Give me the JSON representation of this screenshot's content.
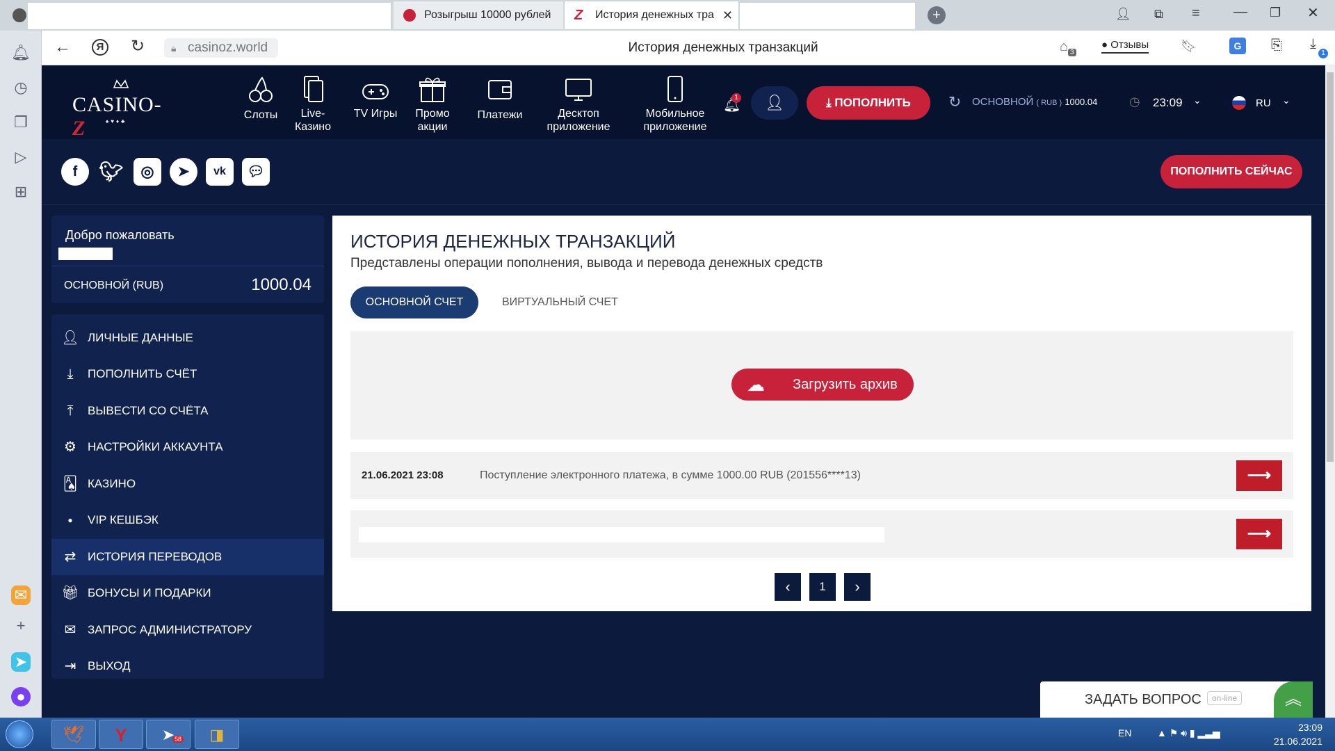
{
  "browser": {
    "tabs": [
      {
        "label": "Розыгрыш 10000 рублей",
        "active": false
      },
      {
        "label": "История денежных тра",
        "active": true
      }
    ],
    "url": "casinoz.world",
    "page_title": "История денежных транзакций",
    "reviews_label": "Отзывы",
    "download_badge": "1",
    "collections_badge": "3"
  },
  "header": {
    "logo_text": "CASINO-Z",
    "nav": [
      {
        "label": "Слоты",
        "icon": "cherry-icon"
      },
      {
        "label": "Live-Казино",
        "icon": "cards-icon"
      },
      {
        "label": "TV Игры",
        "icon": "gamepad-icon"
      },
      {
        "label": "Промо акции",
        "icon": "gift-icon"
      },
      {
        "label": "Платежи",
        "icon": "wallet-icon"
      },
      {
        "label": "Десктоп приложение",
        "icon": "desktop-icon"
      },
      {
        "label": "Мобильное приложение",
        "icon": "mobile-icon"
      }
    ],
    "notifications_badge": "1",
    "deposit_label": "ПОПОЛНИТЬ",
    "balance_label": "ОСНОВНОЙ",
    "balance_currency": "( RUB )",
    "balance_value": "1000.04",
    "time": "23:09",
    "lang": "RU",
    "deposit_now_label": "ПОПОЛНИТЬ СЕЙЧАС"
  },
  "sidebar": {
    "welcome": "Добро пожаловать",
    "account_label": "ОСНОВНОЙ (RUB)",
    "account_value": "1000.04",
    "items": [
      {
        "label": "ЛИЧНЫЕ ДАННЫЕ",
        "icon": "user-plus-icon"
      },
      {
        "label": "ПОПОЛНИТЬ СЧЁТ",
        "icon": "download-icon"
      },
      {
        "label": "ВЫВЕСТИ СО СЧЁТА",
        "icon": "upload-icon"
      },
      {
        "label": "НАСТРОЙКИ АККАУНТА",
        "icon": "gears-icon"
      },
      {
        "label": "КАЗИНО",
        "icon": "cards-icon"
      },
      {
        "label": "VIP КЕШБЭК",
        "icon": "dot-icon"
      },
      {
        "label": "ИСТОРИЯ ПЕРЕВОДОВ",
        "icon": "exchange-icon",
        "active": true
      },
      {
        "label": "БОНУСЫ И ПОДАРКИ",
        "icon": "gift-hand-icon"
      },
      {
        "label": "ЗАПРОС АДМИНИСТРАТОРУ",
        "icon": "envelope-icon"
      },
      {
        "label": "ВЫХОД",
        "icon": "logout-icon"
      }
    ]
  },
  "main": {
    "title": "ИСТОРИЯ ДЕНЕЖНЫХ ТРАНЗАКЦИЙ",
    "subtitle": "Представлены операции пополнения, вывода и перевода денежных средств",
    "tab_main": "ОСНОВНОЙ СЧЕТ",
    "tab_virtual": "ВИРТУАЛЬНЫЙ СЧЕТ",
    "download_archive": "Загрузить архив",
    "transactions": [
      {
        "date": "21.06.2021 23:08",
        "text": "Поступление электронного платежа, в сумме 1000.00 RUB (201556****13)"
      }
    ],
    "page_prev": "‹",
    "page_current": "1",
    "page_next": "›"
  },
  "ask": {
    "label": "ЗАДАТЬ ВОПРОС",
    "status": "on-line"
  },
  "taskbar": {
    "lang": "EN",
    "time": "23:09",
    "date": "21.06.2021",
    "telegram_badge": "58"
  },
  "colors": {
    "accent_red": "#c8213a",
    "dark_navy": "#06122e",
    "navy": "#0c1a3e",
    "panel": "#10224d"
  }
}
